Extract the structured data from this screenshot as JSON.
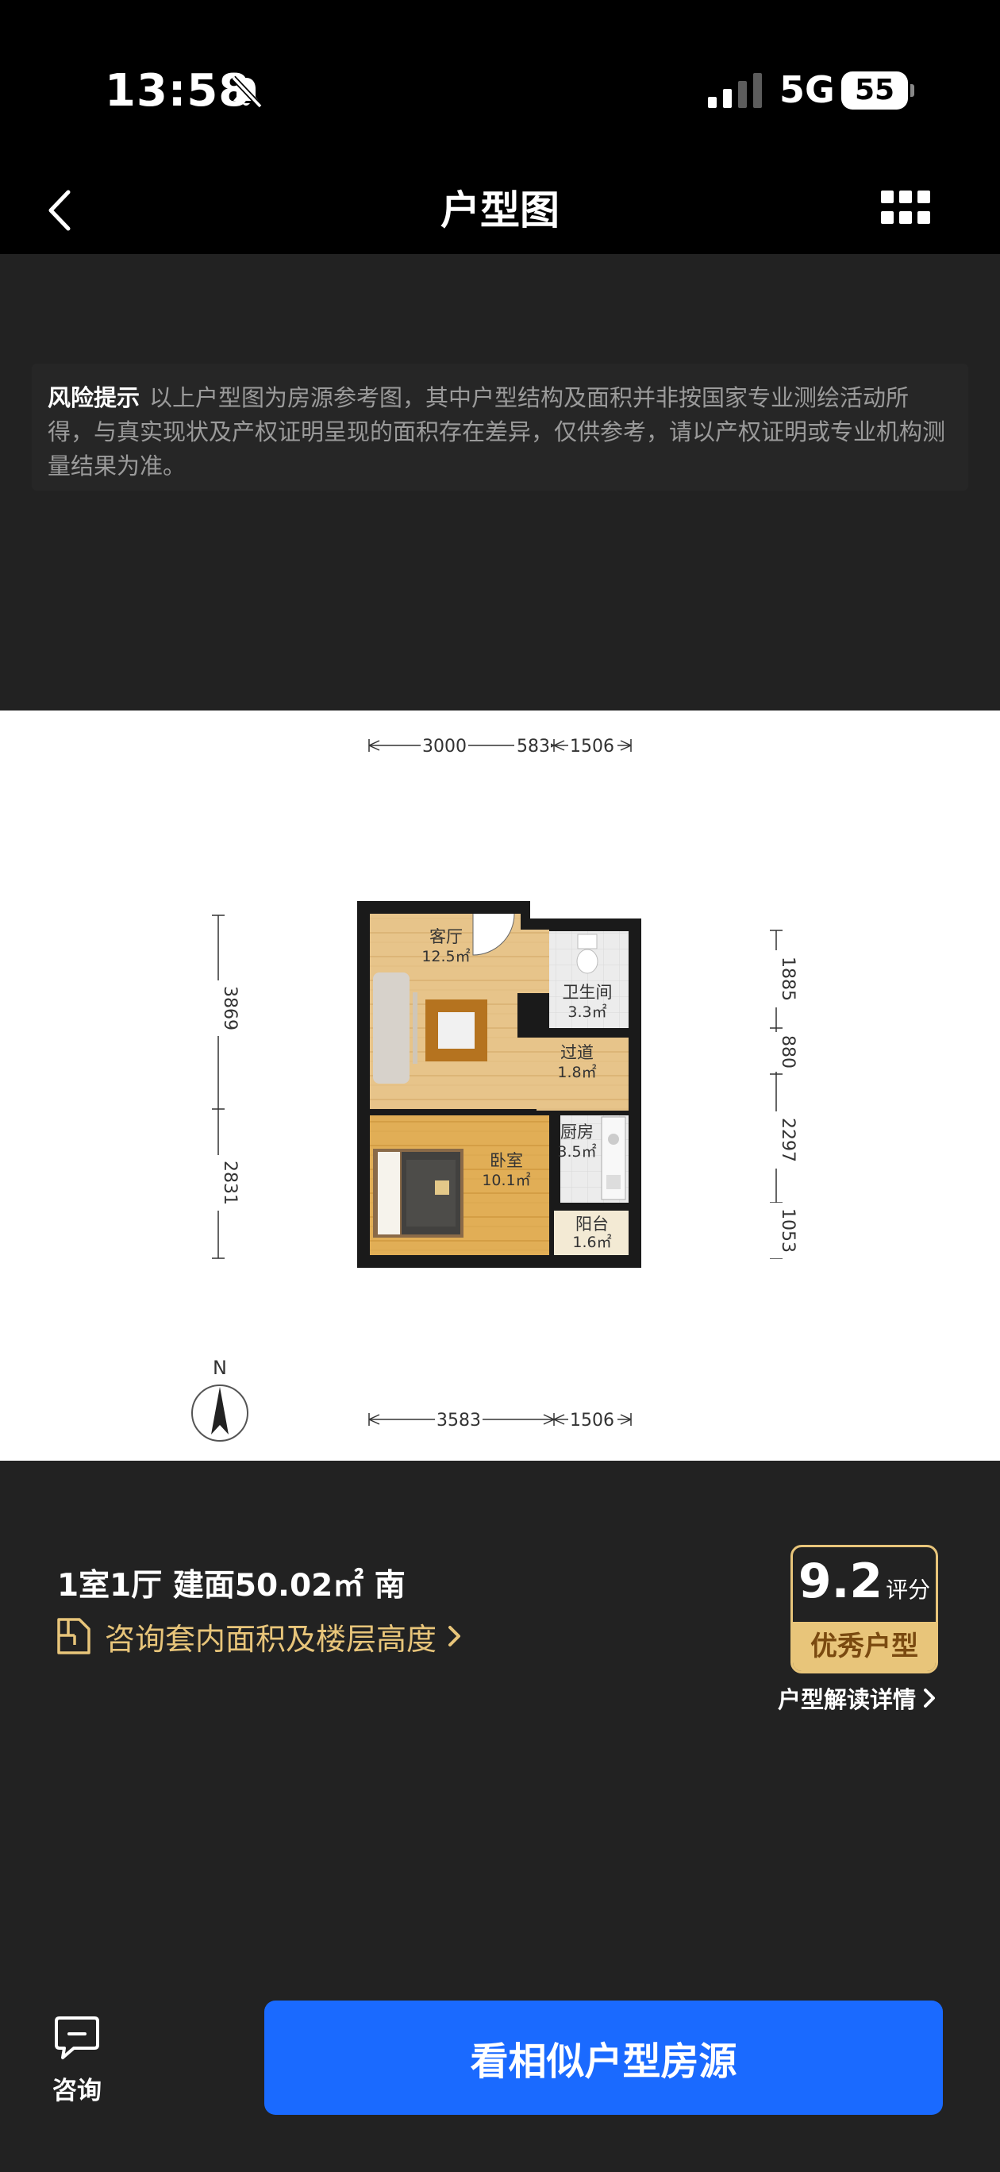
{
  "status_bar": {
    "time": "13:58",
    "network": "5G",
    "battery": "55"
  },
  "nav": {
    "title": "户型图"
  },
  "risk": {
    "label": "风险提示",
    "text": "以上户型图为房源参考图，其中户型结构及面积并非按国家专业测绘活动所得，与真实现状及产权证明呈现的面积存在差异，仅供参考，请以产权证明或专业机构测量结果为准。"
  },
  "floorplan": {
    "top_dims": [
      "3000",
      "583",
      "1506"
    ],
    "bottom_dims": [
      "3583",
      "1506"
    ],
    "left_dims": [
      "3869",
      "2831"
    ],
    "right_dims": [
      "1885",
      "880",
      "2297",
      "1053"
    ],
    "compass": "N",
    "rooms": [
      {
        "name": "客厅",
        "area": "12.5㎡"
      },
      {
        "name": "卫生间",
        "area": "3.3㎡"
      },
      {
        "name": "过道",
        "area": "1.8㎡"
      },
      {
        "name": "厨房",
        "area": "3.5㎡"
      },
      {
        "name": "卧室",
        "area": "10.1㎡"
      },
      {
        "name": "阳台",
        "area": "1.6㎡"
      }
    ]
  },
  "info": {
    "title": "1室1厅  建面50.02㎡ 南",
    "consult_link": "咨询套内面积及楼层高度"
  },
  "score": {
    "value": "9.2",
    "unit": "评分",
    "badge": "优秀户型",
    "detail_link": "户型解读详情"
  },
  "bottom": {
    "consult_label": "咨询",
    "cta": "看相似户型房源"
  },
  "colors": {
    "accent": "#1a6aff",
    "gold": "#e8c57a",
    "background": "#222222"
  }
}
